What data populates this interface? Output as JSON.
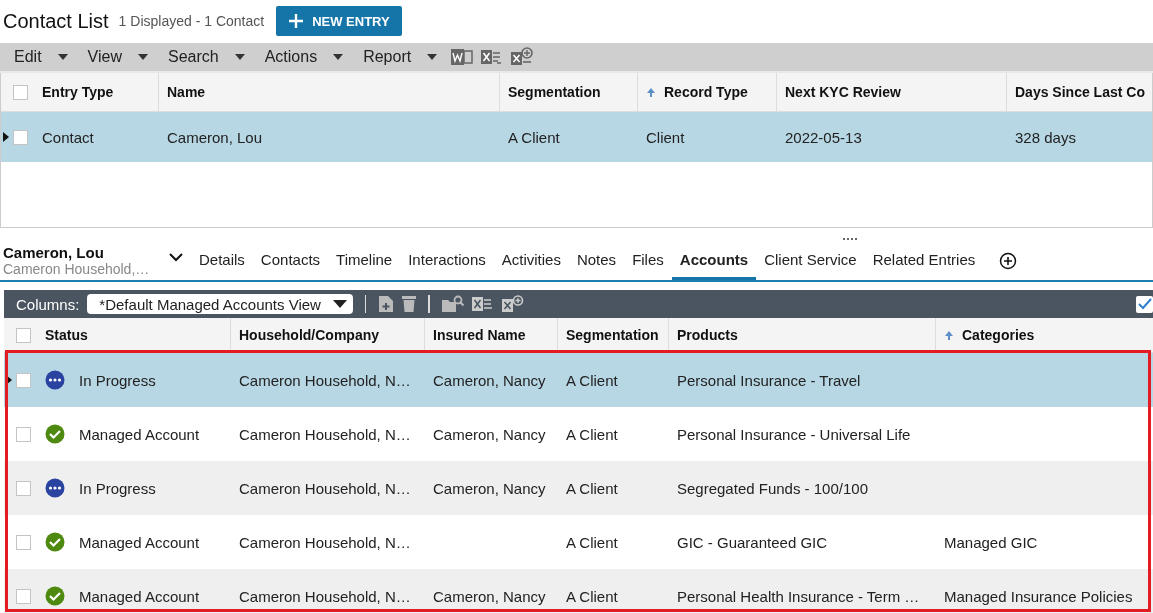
{
  "header": {
    "title": "Contact List",
    "summary": "1 Displayed - 1 Contact",
    "new_button": "NEW ENTRY"
  },
  "menu": [
    {
      "label": "Edit"
    },
    {
      "label": "View"
    },
    {
      "label": "Search"
    },
    {
      "label": "Actions"
    },
    {
      "label": "Report"
    }
  ],
  "contacts": {
    "all_checked": false,
    "columns": [
      {
        "label": "Entry Type",
        "sorted": false
      },
      {
        "label": "Name",
        "sorted": false
      },
      {
        "label": "Segmentation",
        "sorted": false
      },
      {
        "label": "Record Type",
        "sorted": true
      },
      {
        "label": "Next KYC Review",
        "sorted": false
      },
      {
        "label": "Days Since Last Co",
        "sorted": false
      }
    ],
    "rows": [
      {
        "selected": true,
        "checked": false,
        "cells": [
          "Contact",
          "Cameron, Lou",
          "A Client",
          "Client",
          "2022-05-13",
          "328 days"
        ]
      }
    ]
  },
  "entry": {
    "name": "Cameron, Lou",
    "subtitle": "Cameron Household,…"
  },
  "tabs": [
    {
      "label": "Details",
      "selected": false
    },
    {
      "label": "Contacts",
      "selected": false
    },
    {
      "label": "Timeline",
      "selected": false
    },
    {
      "label": "Interactions",
      "selected": false
    },
    {
      "label": "Activities",
      "selected": false
    },
    {
      "label": "Notes",
      "selected": false
    },
    {
      "label": "Files",
      "selected": false
    },
    {
      "label": "Accounts",
      "selected": true
    },
    {
      "label": "Client Service",
      "selected": false
    },
    {
      "label": "Related Entries",
      "selected": false
    }
  ],
  "accounts": {
    "all_checked": false,
    "columns_label": "Columns:",
    "view": "*Default Managed Accounts View",
    "show_all_checked": true,
    "columns": [
      {
        "label": "Status",
        "sorted": false
      },
      {
        "label": "Household/Company",
        "sorted": false
      },
      {
        "label": "Insured Name",
        "sorted": false
      },
      {
        "label": "Segmentation",
        "sorted": false
      },
      {
        "label": "Products",
        "sorted": false
      },
      {
        "label": "Categories",
        "sorted": true
      }
    ],
    "rows": [
      {
        "selected": true,
        "checked": false,
        "kind": "progress",
        "cells": [
          "In Progress",
          "Cameron Household, N…",
          "Cameron, Nancy",
          "A Client",
          "Personal Insurance - Travel",
          ""
        ]
      },
      {
        "selected": false,
        "checked": false,
        "kind": "managed",
        "cells": [
          "Managed Account",
          "Cameron Household, N…",
          "Cameron, Nancy",
          "A Client",
          "Personal Insurance - Universal Life",
          ""
        ]
      },
      {
        "selected": false,
        "checked": false,
        "kind": "progress",
        "cells": [
          "In Progress",
          "Cameron Household, N…",
          "Cameron, Nancy",
          "A Client",
          "Segregated Funds - 100/100",
          ""
        ]
      },
      {
        "selected": false,
        "checked": false,
        "kind": "managed",
        "cells": [
          "Managed Account",
          "Cameron Household, N…",
          "",
          "A Client",
          "GIC - Guaranteed GIC",
          "Managed GIC"
        ]
      },
      {
        "selected": false,
        "checked": false,
        "kind": "managed",
        "cells": [
          "Managed Account",
          "Cameron Household, N…",
          "Cameron, Nancy",
          "A Client",
          "Personal Health Insurance - Term …",
          "Managed Insurance Policies"
        ]
      }
    ]
  }
}
